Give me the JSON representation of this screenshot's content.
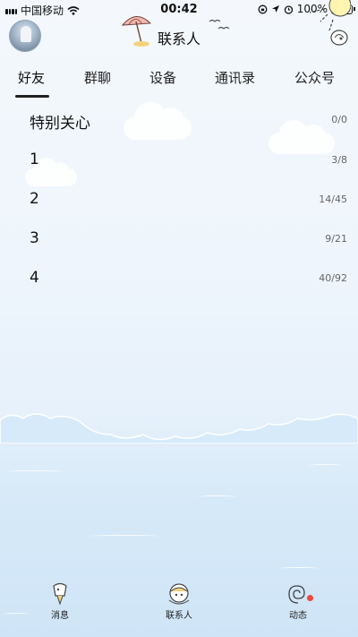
{
  "status_bar": {
    "carrier": "中国移动",
    "time": "00:42",
    "battery": "100%"
  },
  "header": {
    "title": "联系人"
  },
  "tabs": [
    {
      "label": "好友",
      "active": true
    },
    {
      "label": "群聊",
      "active": false
    },
    {
      "label": "设备",
      "active": false
    },
    {
      "label": "通讯录",
      "active": false
    },
    {
      "label": "公众号",
      "active": false
    }
  ],
  "groups": [
    {
      "name": "特别关心",
      "count": "0/0"
    },
    {
      "name": "1",
      "count": "3/8"
    },
    {
      "name": "2",
      "count": "14/45"
    },
    {
      "name": "3",
      "count": "9/21"
    },
    {
      "name": "4",
      "count": "40/92"
    }
  ],
  "bottom_nav": [
    {
      "label": "消息",
      "icon": "message-icon"
    },
    {
      "label": "联系人",
      "icon": "contacts-icon"
    },
    {
      "label": "动态",
      "icon": "moments-icon",
      "badge": true
    }
  ],
  "colors": {
    "badge": "#f2453d",
    "text": "#111111",
    "sky": "#eef5fc",
    "sea": "#cfe5f7"
  }
}
